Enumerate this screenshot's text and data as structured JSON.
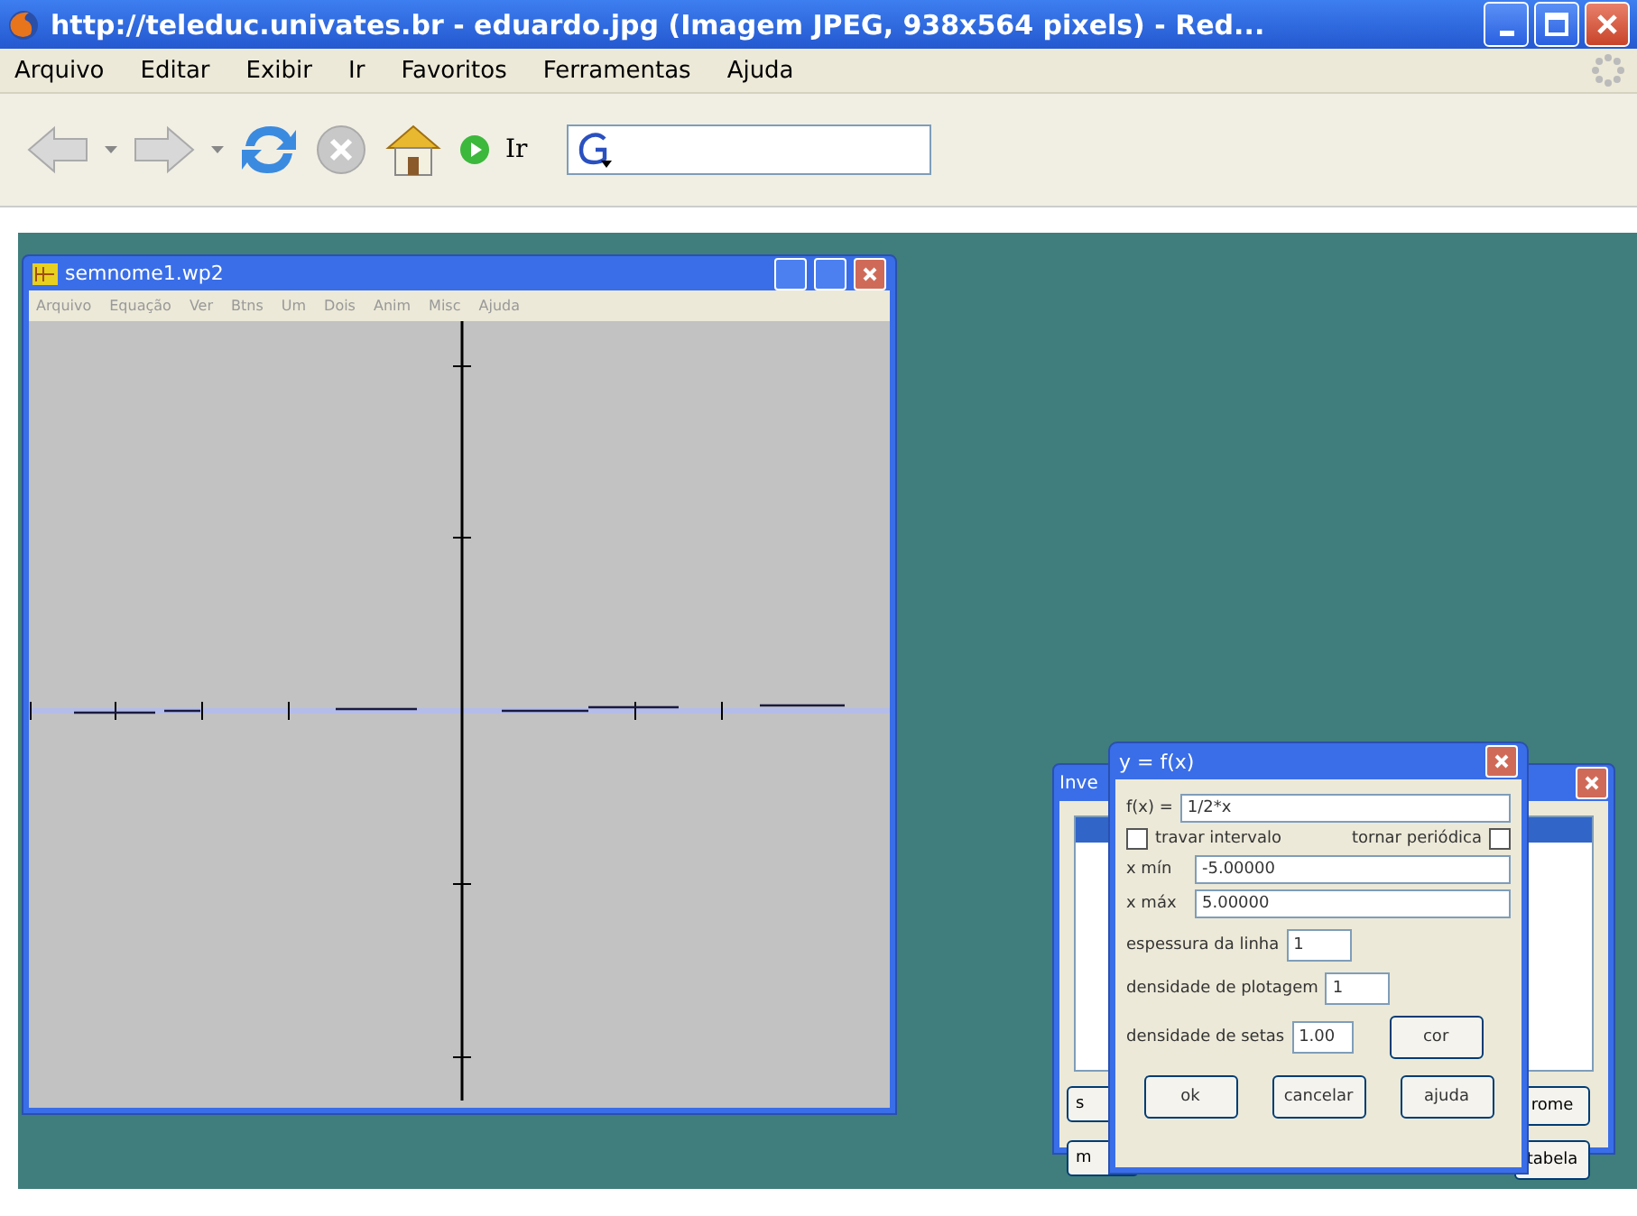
{
  "browser": {
    "title": "http://teleduc.univates.br - eduardo.jpg (Imagem JPEG, 938x564 pixels) - Red...",
    "menu": [
      "Arquivo",
      "Editar",
      "Exibir",
      "Ir",
      "Favoritos",
      "Ferramentas",
      "Ajuda"
    ],
    "go_label": "Ir"
  },
  "plot_window": {
    "title": "semnome1.wp2",
    "menu": [
      "Arquivo",
      "Equação",
      "Ver",
      "Btns",
      "Um",
      "Dois",
      "Anim",
      "Misc",
      "Ajuda"
    ]
  },
  "inventory_window": {
    "title": "Inve",
    "buttons_left": [
      "s",
      "m"
    ],
    "buttons_right": [
      "rome",
      "tabela"
    ]
  },
  "dialog": {
    "title": "y = f(x)",
    "function": {
      "label": "f(x) =",
      "value": "1/2*x"
    },
    "checkboxes": [
      {
        "label": "travar intervalo",
        "checked": false
      },
      {
        "label": "tornar periódica",
        "checked": false
      }
    ],
    "range": [
      {
        "label": "x mín",
        "value": "-5.00000"
      },
      {
        "label": "x máx",
        "value": "5.00000"
      }
    ],
    "settings": [
      {
        "label": "espessura da linha",
        "value": "1"
      },
      {
        "label": "densidade de plotagem",
        "value": "1"
      },
      {
        "label": "densidade de setas",
        "value": "1.00"
      }
    ],
    "color_button": "cor",
    "buttons": [
      "ok",
      "cancelar",
      "ajuda"
    ]
  }
}
